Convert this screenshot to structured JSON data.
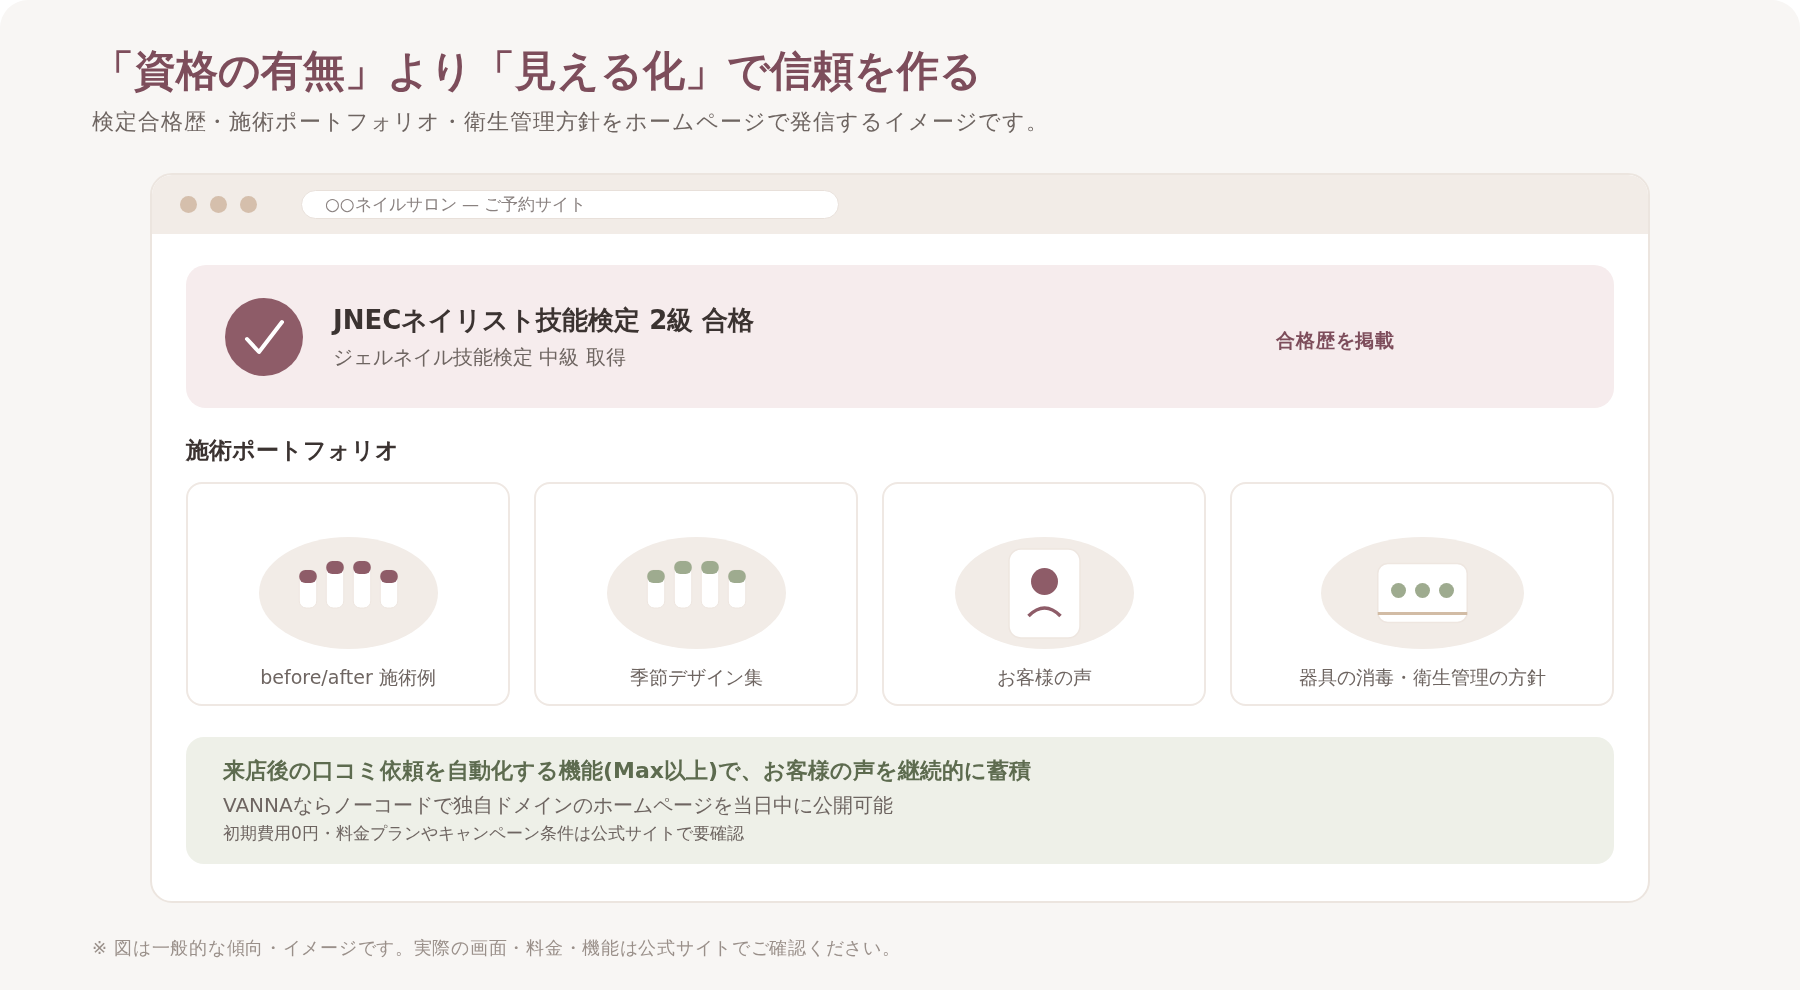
{
  "header": {
    "title": "「資格の有無」より「見える化」で信頼を作る",
    "subtitle": "検定合格歴・施術ポートフォリオ・衛生管理方針をホームページで発信するイメージです。"
  },
  "browser": {
    "address": "○○ネイルサロン — ご予約サイト",
    "certification": {
      "title": "JNECネイリスト技能検定 2級 合格",
      "subtitle": "ジェルネイル技能検定 中級 取得",
      "note": "合格歴を掲載"
    },
    "portfolio": {
      "heading": "施術ポートフォリオ",
      "items": [
        {
          "kind": "nails",
          "color": "#8e5c68",
          "label": "before/after 施術例"
        },
        {
          "kind": "nails",
          "color": "#9eab8f",
          "label": "季節デザイン集"
        },
        {
          "kind": "person",
          "label": "お客様の声"
        },
        {
          "kind": "hygiene",
          "label": "器具の消毒・衛生管理の方針"
        }
      ]
    },
    "notice": {
      "headline": "来店後の口コミ依頼を自動化する機能(Max以上)で、お客様の声を継続的に蓄積",
      "text": "VANNAならノーコードで独自ドメインのホームページを当日中に公開可能",
      "note": "初期費用0円・料金プランやキャンペーン条件は公式サイトで要確認"
    }
  },
  "footnote": "※ 図は一般的な傾向・イメージです。実際の画面・料金・機能は公式サイトでご確認ください。"
}
